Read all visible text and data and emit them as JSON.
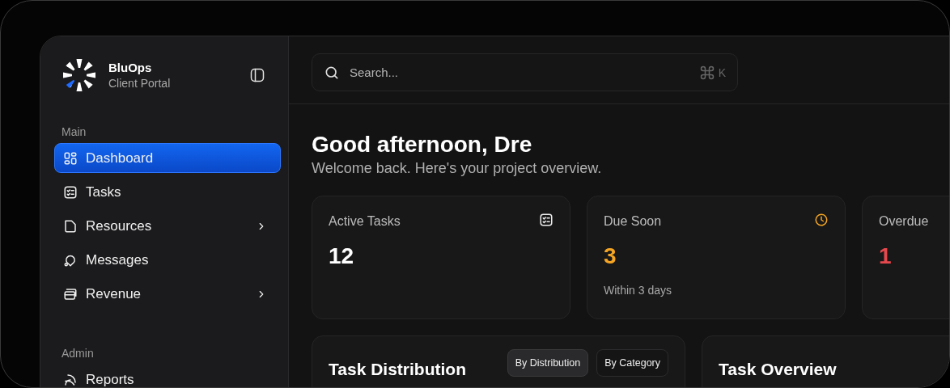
{
  "brand": {
    "name": "BluOps",
    "subtitle": "Client Portal"
  },
  "sidebar": {
    "sections": [
      {
        "label": "Main",
        "items": [
          {
            "label": "Dashboard",
            "kind": "dashboard",
            "selected": true,
            "has_submenu": false
          },
          {
            "label": "Tasks",
            "kind": "tasks",
            "selected": false,
            "has_submenu": false
          },
          {
            "label": "Resources",
            "kind": "resources",
            "selected": false,
            "has_submenu": true
          },
          {
            "label": "Messages",
            "kind": "messages",
            "selected": false,
            "has_submenu": false
          },
          {
            "label": "Revenue",
            "kind": "revenue",
            "selected": false,
            "has_submenu": true
          }
        ]
      },
      {
        "label": "Admin",
        "items": [
          {
            "label": "Reports",
            "kind": "reports",
            "selected": false,
            "has_submenu": false
          }
        ]
      }
    ]
  },
  "search": {
    "placeholder": "Search...",
    "shortcut_key": "K"
  },
  "greeting": {
    "title": "Good afternoon, Dre",
    "subtitle": "Welcome back. Here's your project overview."
  },
  "stats": [
    {
      "label": "Active Tasks",
      "value": "12",
      "kind": "tasks",
      "color": "#ffffff"
    },
    {
      "label": "Due Soon",
      "value": "3",
      "note": "Within 3 days",
      "kind": "due",
      "color": "#f5a524"
    },
    {
      "label": "Overdue",
      "value": "1",
      "kind": "overdue",
      "color": "#e5484d"
    }
  ],
  "panels": [
    {
      "title": "Task Distribution",
      "tabs": [
        {
          "label": "By Distribution",
          "selected": true
        },
        {
          "label": "By Category",
          "selected": false
        }
      ]
    },
    {
      "title": "Task Overview"
    }
  ]
}
